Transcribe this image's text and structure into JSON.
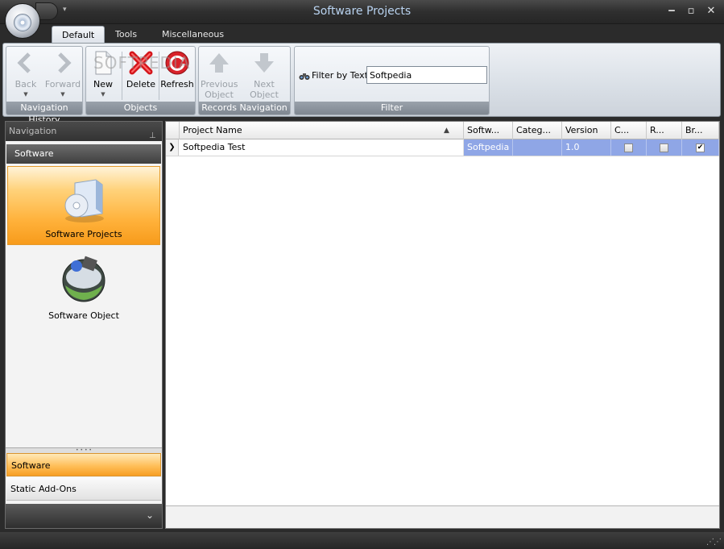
{
  "window": {
    "title": "Software Projects"
  },
  "tabs": [
    {
      "label": "Default",
      "active": true
    },
    {
      "label": "Tools",
      "active": false
    },
    {
      "label": "Miscellaneous",
      "active": false
    }
  ],
  "ribbon": {
    "navigation_history": {
      "caption": "Navigation History",
      "back": "Back",
      "forward": "Forward"
    },
    "objects": {
      "caption": "Objects",
      "new": "New",
      "delete": "Delete",
      "refresh": "Refresh"
    },
    "records_navigation": {
      "caption": "Records Navigation",
      "previous_line1": "Previous",
      "previous_line2": "Object",
      "next": "Next Object"
    },
    "filter": {
      "caption": "Filter",
      "label": "Filter by Text",
      "value": "Softpedia"
    }
  },
  "watermark": "SOFTPEDIA",
  "navigation": {
    "header": "Navigation",
    "group": "Software",
    "items": [
      {
        "label": "Software Projects",
        "selected": true
      },
      {
        "label": "Software Object",
        "selected": false
      }
    ],
    "bottom_groups": [
      {
        "label": "Software",
        "selected": true
      },
      {
        "label": "Static Add-Ons",
        "selected": false
      }
    ]
  },
  "grid": {
    "columns": [
      "Project Name",
      "Softw...",
      "Categ...",
      "Version",
      "C...",
      "R...",
      "Br..."
    ],
    "sort_indicator": "▲",
    "rows": [
      {
        "project_name": "Softpedia Test",
        "software": "Softpedia",
        "category": "",
        "version": "1.0",
        "c": false,
        "r": false,
        "br": true
      }
    ]
  },
  "colors": {
    "accent_orange": "#f79b1b",
    "selection_blue": "#8fa6e6",
    "title_text": "#b9d3f0"
  }
}
